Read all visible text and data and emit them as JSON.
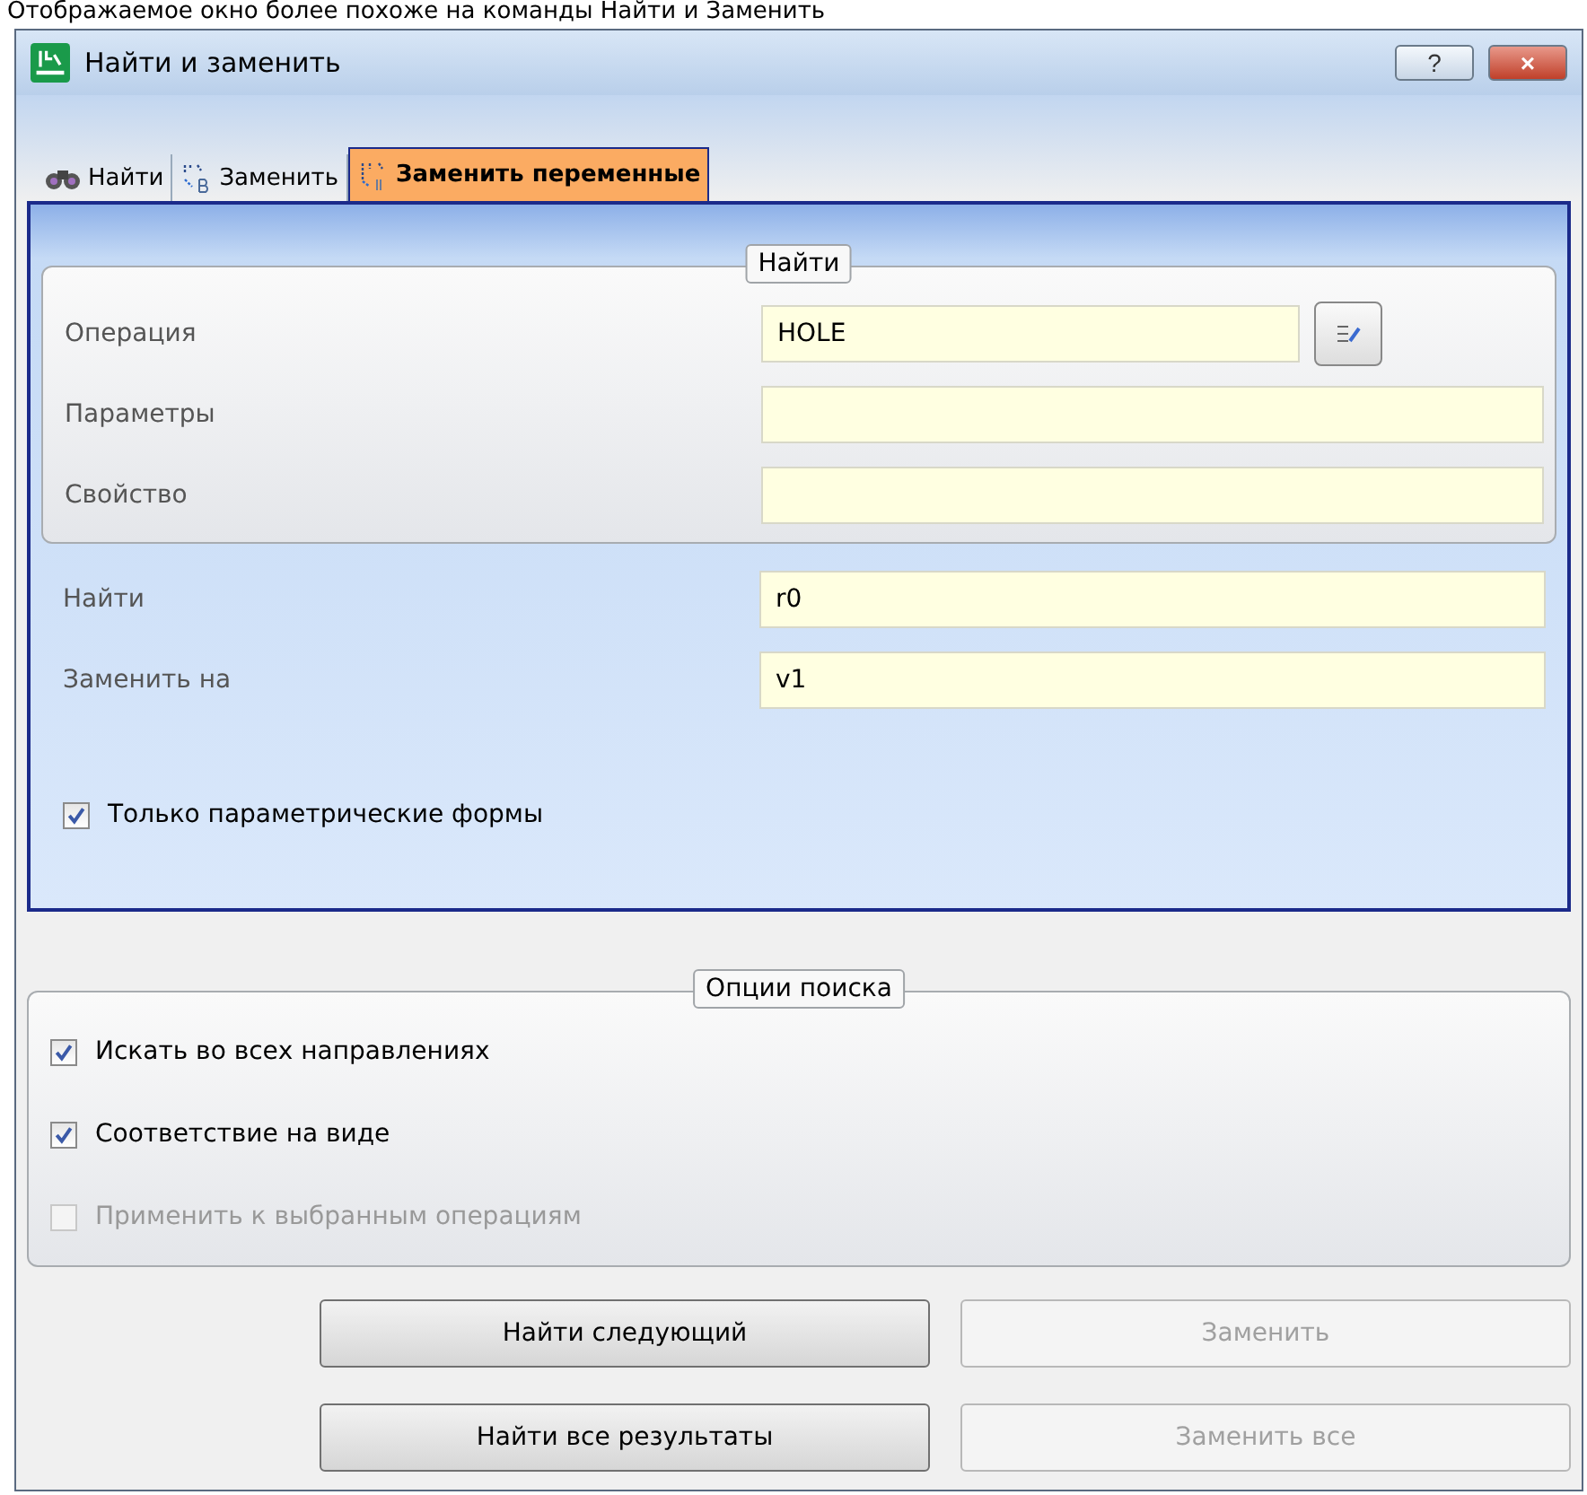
{
  "caption": "Отображаемое окно более похоже на команды Найти и Заменить",
  "window": {
    "title": "Найти и заменить",
    "help": "?",
    "close": "×"
  },
  "tabs": [
    {
      "label": "Найти",
      "selected": false,
      "kind": "find"
    },
    {
      "label": "Заменить",
      "selected": false,
      "kind": "replace"
    },
    {
      "label": "Заменить переменные",
      "selected": true,
      "kind": "variables"
    }
  ],
  "find_group": {
    "title": "Найти",
    "fields": [
      {
        "label": "Операция",
        "value": "HOLE",
        "picker": true
      },
      {
        "label": "Параметры",
        "picker": false
      },
      {
        "label": "Свойство",
        "picker": false
      }
    ]
  },
  "replace_fields": [
    {
      "label": "Найти",
      "value": "r0"
    },
    {
      "label": "Заменить на",
      "value": "v1"
    }
  ],
  "parametric_only": {
    "label": "Только параметрические формы",
    "checked": true,
    "disabled": false
  },
  "options_group": {
    "title": "Опции поиска",
    "options": [
      {
        "label": "Искать во всех направлениях",
        "checked": true,
        "disabled": false
      },
      {
        "label": "Соответствие на виде",
        "checked": true,
        "disabled": false
      },
      {
        "label": "Применить к выбранным операциям",
        "checked": false,
        "disabled": true
      }
    ]
  },
  "buttons": [
    {
      "label": "Найти следующий",
      "disabled": false
    },
    {
      "label": "Заменить",
      "disabled": true
    },
    {
      "label": "Найти все результаты",
      "disabled": false
    },
    {
      "label": "Заменить все",
      "disabled": true
    }
  ]
}
